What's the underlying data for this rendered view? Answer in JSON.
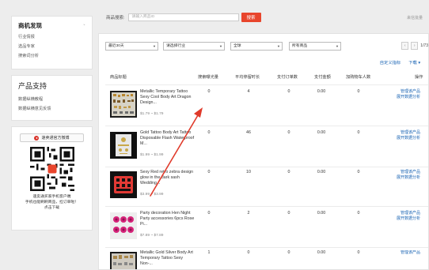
{
  "sidebar": {
    "panel1": {
      "title": "商机发现",
      "links": [
        "行业情报",
        "选品专家",
        "搜索词分析"
      ]
    },
    "panel2": {
      "title": "产品支持",
      "links": [
        "数据纵横教程",
        "数据纵横意见反馈"
      ]
    },
    "panel3": {
      "follow_label": "速卖通官方微博",
      "qr_text": [
        "速卖通买家手机客户端",
        "手机也能刷刷商品，捡订单啦！",
        "点击下载"
      ]
    }
  },
  "search": {
    "label": "商品搜索:",
    "placeholder": "请输入商品ID",
    "button": "搜索",
    "right_link": "来信批量"
  },
  "filters": {
    "period": "最近30天",
    "industry": "请选择行业",
    "region": "全球",
    "product": "所有商品",
    "pager_prev": "‹",
    "pager_next": "›",
    "pager_text": "1/73"
  },
  "toolbar": {
    "custom": "自定义指标",
    "download": "下载"
  },
  "table": {
    "headers": {
      "product": "商品标题",
      "exposure": "搜索曝光量",
      "stay": "平均停留时长",
      "orders": "支付订单数",
      "amount": "支付金额",
      "cart": "加购物车人数",
      "ops": "操作"
    },
    "rows": [
      {
        "name": "Metallic Temporary Tattoo Sexy Cool Body Art Dragon Design...",
        "price": "$1.79 ~ $1.79",
        "exposure": "0",
        "stay": "4",
        "orders": "0",
        "amount": "0.00",
        "cart": "0",
        "op1": "管理该产品",
        "op2": "展开数据分析"
      },
      {
        "name": "Gold Tattoo Body Art Tattoo Disposable Flash Waterproof M...",
        "price": "$1.99 ~ $1.99",
        "exposure": "0",
        "stay": "46",
        "orders": "0",
        "amount": "0.00",
        "cart": "0",
        "op1": "管理该产品",
        "op2": "展开数据分析"
      },
      {
        "name": "Sexy Red retro zebra design glow in the dark sash Wedding...",
        "price": "$3.99 ~ $3.99",
        "exposure": "0",
        "stay": "10",
        "orders": "0",
        "amount": "0.00",
        "cart": "0",
        "op1": "管理该产品",
        "op2": "展开数据分析"
      },
      {
        "name": "Party decoration Hen Night Party accessories 6pcs Rose Pi...",
        "price": "$7.89 ~ $7.89",
        "exposure": "0",
        "stay": "2",
        "orders": "0",
        "amount": "0.00",
        "cart": "0",
        "op1": "管理该产品",
        "op2": "展开数据分析"
      },
      {
        "name": "Metallic Gold Silver Body Art Temporary Tattoo Sexy Non-...",
        "price": "",
        "exposure": "1",
        "stay": "0",
        "orders": "0",
        "amount": "0.00",
        "cart": "0",
        "op1": "管理该产品",
        "op2": ""
      }
    ]
  },
  "colors": {
    "accent": "#e8452c",
    "link": "#1a64b4",
    "annotation_arrow": "#e03a2a"
  }
}
